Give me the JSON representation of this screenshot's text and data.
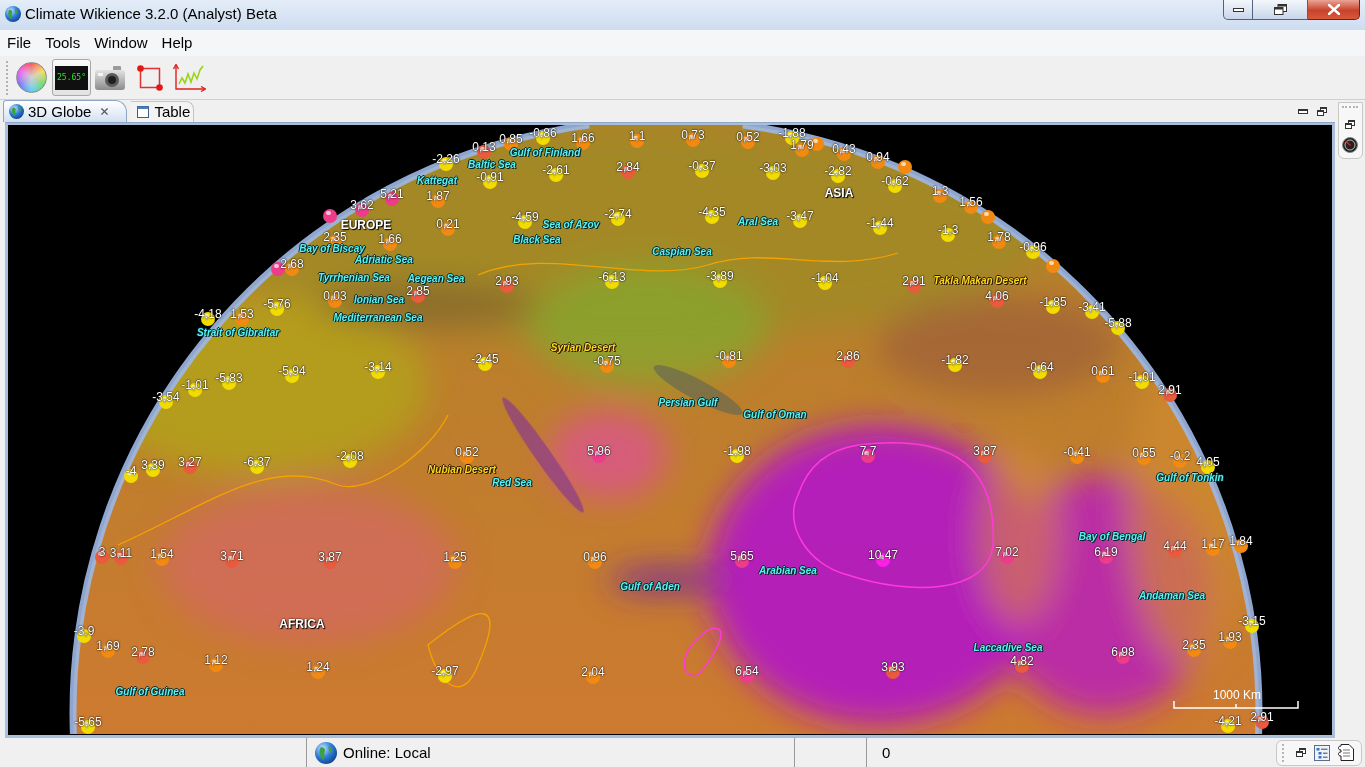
{
  "window": {
    "title": "Climate Wikience 3.2.0 (Analyst) Beta"
  },
  "menu": [
    "File",
    "Tools",
    "Window",
    "Help"
  ],
  "toolbar": {
    "temperature_display": "25.65°"
  },
  "tabs": [
    {
      "label": "3D Globe",
      "selected": true
    },
    {
      "label": "Table",
      "selected": false
    }
  ],
  "globe": {
    "labels": [
      {
        "kind": "water",
        "text": "Gulf of Finland"
      },
      {
        "kind": "water",
        "text": "Baltic Sea"
      },
      {
        "kind": "water",
        "text": "Kattegat"
      },
      {
        "kind": "continent",
        "text": "ASIA"
      },
      {
        "kind": "continent",
        "text": "EUROPE"
      },
      {
        "kind": "water",
        "text": "Sea of Azov"
      },
      {
        "kind": "water",
        "text": "Aral Sea"
      },
      {
        "kind": "water",
        "text": "Black Sea"
      },
      {
        "kind": "water",
        "text": "Bay of Biscay"
      },
      {
        "kind": "water",
        "text": "Caspian Sea"
      },
      {
        "kind": "water",
        "text": "Adriatic Sea"
      },
      {
        "kind": "water",
        "text": "Tyrrhenian Sea"
      },
      {
        "kind": "water",
        "text": "Aegean Sea"
      },
      {
        "kind": "desert",
        "text": "Takla Makan Desert"
      },
      {
        "kind": "water",
        "text": "Ionian Sea"
      },
      {
        "kind": "water",
        "text": "Mediterranean Sea"
      },
      {
        "kind": "water",
        "text": "Strait of Gibraltar"
      },
      {
        "kind": "desert",
        "text": "Syrian Desert"
      },
      {
        "kind": "water",
        "text": "Persian Gulf"
      },
      {
        "kind": "water",
        "text": "Gulf of Oman"
      },
      {
        "kind": "desert",
        "text": "Nubian Desert"
      },
      {
        "kind": "water",
        "text": "Red Sea"
      },
      {
        "kind": "water",
        "text": "Gulf of Tonkin"
      },
      {
        "kind": "water",
        "text": "Bay of Bengal"
      },
      {
        "kind": "water",
        "text": "Arabian Sea"
      },
      {
        "kind": "water",
        "text": "Gulf of Aden"
      },
      {
        "kind": "water",
        "text": "Andaman Sea"
      },
      {
        "kind": "continent",
        "text": "AFRICA"
      },
      {
        "kind": "water",
        "text": "Laccadive Sea"
      },
      {
        "kind": "water",
        "text": "Gulf of Guinea"
      }
    ],
    "markers": [
      {
        "value": "0,85",
        "color": "#f28a12"
      },
      {
        "value": "-0,86",
        "color": "#f2dc00"
      },
      {
        "value": "1,66",
        "color": "#f28a12"
      },
      {
        "value": "1,1",
        "color": "#f28a12"
      },
      {
        "value": "0,73",
        "color": "#f28a12"
      },
      {
        "value": "0,52",
        "color": "#f28a12"
      },
      {
        "value": "-1,88",
        "color": "#f2dc00"
      },
      {
        "value": "0,13",
        "color": "#ea5a3c"
      },
      {
        "value": "1,79",
        "color": "#f28a12"
      },
      {
        "color": "#f28a12"
      },
      {
        "value": "0,43",
        "color": "#f28a12"
      },
      {
        "value": "-2,26",
        "color": "#f2dc00"
      },
      {
        "value": "0,94",
        "color": "#f28a12"
      },
      {
        "value": "-2,61",
        "color": "#f2dc00"
      },
      {
        "value": "2,84",
        "color": "#ea5a3c"
      },
      {
        "value": "-0,37",
        "color": "#f2dc00"
      },
      {
        "value": "-3,03",
        "color": "#f2dc00"
      },
      {
        "value": "-2,82",
        "color": "#f2dc00"
      },
      {
        "color": "#f28a12"
      },
      {
        "value": "-0,91",
        "color": "#f2dc00"
      },
      {
        "value": "-0,62",
        "color": "#f2dc00"
      },
      {
        "value": "5,21",
        "color": "#ec3c8a"
      },
      {
        "value": "1,87",
        "color": "#f28a12"
      },
      {
        "value": "1,3",
        "color": "#f28a12"
      },
      {
        "value": "3,62",
        "color": "#ec3c8a"
      },
      {
        "value": "1,56",
        "color": "#f28a12"
      },
      {
        "color": "#ec3c8a"
      },
      {
        "value": "-4,59",
        "color": "#f2dc00"
      },
      {
        "value": "-2,74",
        "color": "#f2dc00"
      },
      {
        "value": "-4,35",
        "color": "#f2dc00"
      },
      {
        "value": "-3,47",
        "color": "#f2dc00"
      },
      {
        "color": "#f28a12"
      },
      {
        "value": "0,21",
        "color": "#f28a12"
      },
      {
        "value": "-1,44",
        "color": "#f2dc00"
      },
      {
        "value": "-1,3",
        "color": "#f2dc00"
      },
      {
        "value": "2,35",
        "color": "#f28a12"
      },
      {
        "value": "1,66",
        "color": "#f28a12"
      },
      {
        "value": "1,78",
        "color": "#f28a12"
      },
      {
        "value": "-0,96",
        "color": "#f2dc00"
      },
      {
        "color": "#ec3c8a"
      },
      {
        "value": "2,68",
        "color": "#f28a12"
      },
      {
        "color": "#f28a12"
      },
      {
        "value": "2,93",
        "color": "#ea5a3c"
      },
      {
        "value": "-6,13",
        "color": "#f2dc00"
      },
      {
        "value": "-3,89",
        "color": "#f2dc00"
      },
      {
        "value": "-1,04",
        "color": "#f2dc00"
      },
      {
        "value": "2,91",
        "color": "#ea5a3c"
      },
      {
        "value": "0,03",
        "color": "#f28a12"
      },
      {
        "value": "2,85",
        "color": "#ea5a3c"
      },
      {
        "value": "4,06",
        "color": "#ea5a3c"
      },
      {
        "value": "-5,76",
        "color": "#f2dc00"
      },
      {
        "value": "-1,85",
        "color": "#f2dc00"
      },
      {
        "value": "-3,41",
        "color": "#f2dc00"
      },
      {
        "value": "-4,18",
        "color": "#f2dc00"
      },
      {
        "value": "1,53",
        "color": "#f28a12"
      },
      {
        "value": "-5,88",
        "color": "#f2dc00"
      },
      {
        "value": "-2,45",
        "color": "#f2dc00"
      },
      {
        "value": "-0,75",
        "color": "#f28a12"
      },
      {
        "value": "-0,81",
        "color": "#f28a12"
      },
      {
        "value": "2,86",
        "color": "#ea5a3c"
      },
      {
        "value": "-1,82",
        "color": "#f2dc00"
      },
      {
        "value": "-5,94",
        "color": "#f2dc00"
      },
      {
        "value": "-3,14",
        "color": "#f2dc00"
      },
      {
        "value": "-0,64",
        "color": "#f2dc00"
      },
      {
        "value": "0,61",
        "color": "#f28a12"
      },
      {
        "value": "-5,83",
        "color": "#f2dc00"
      },
      {
        "value": "-1,01",
        "color": "#f2dc00"
      },
      {
        "value": "-1,01",
        "color": "#f2dc00"
      },
      {
        "value": "2,91",
        "color": "#ea5a3c"
      },
      {
        "value": "-3,54",
        "color": "#f2dc00"
      },
      {
        "value": "-2,08",
        "color": "#f2dc00"
      },
      {
        "value": "0,52",
        "color": "#f28a12"
      },
      {
        "value": "5,96",
        "color": "#ec3c8a"
      },
      {
        "value": "-1,98",
        "color": "#f2dc00"
      },
      {
        "value": "7,7",
        "color": "#ec3c8a"
      },
      {
        "value": "3,87",
        "color": "#ea5a3c"
      },
      {
        "value": "-0,41",
        "color": "#f28a12"
      },
      {
        "value": "0,55",
        "color": "#f28a12"
      },
      {
        "value": "-0,2",
        "color": "#f28a12"
      },
      {
        "value": "3,39",
        "color": "#f2dc00"
      },
      {
        "value": "3,27",
        "color": "#ea5a3c"
      },
      {
        "value": "-6,37",
        "color": "#f2dc00"
      },
      {
        "value": "4,05",
        "color": "#f2dc00"
      },
      {
        "value": "-4",
        "color": "#f2dc00"
      },
      {
        "value": "4,44",
        "color": "#ea5a3c"
      },
      {
        "value": "1,17",
        "color": "#f28a12"
      },
      {
        "value": "1,84",
        "color": "#f28a12"
      },
      {
        "value": "3",
        "color": "#ea5a3c"
      },
      {
        "value": "3,11",
        "color": "#ea5a3c"
      },
      {
        "value": "1,54",
        "color": "#f28a12"
      },
      {
        "value": "3,71",
        "color": "#ea5a3c"
      },
      {
        "value": "3,87",
        "color": "#ea5a3c"
      },
      {
        "value": "1,25",
        "color": "#f28a12"
      },
      {
        "value": "0,96",
        "color": "#f28a12"
      },
      {
        "value": "5,65",
        "color": "#ec3c8a"
      },
      {
        "value": "10,47",
        "color": "#ff1ee8"
      },
      {
        "value": "7,02",
        "color": "#ec3c8a"
      },
      {
        "value": "6,19",
        "color": "#ec3c8a"
      },
      {
        "value": "-3,15",
        "color": "#f2dc00"
      },
      {
        "value": "-3,9",
        "color": "#f2dc00"
      },
      {
        "value": "1,93",
        "color": "#f28a12"
      },
      {
        "value": "1,69",
        "color": "#f28a12"
      },
      {
        "value": "2,35",
        "color": "#f28a12"
      },
      {
        "value": "2,78",
        "color": "#ea5a3c"
      },
      {
        "value": "6,98",
        "color": "#ec3c8a"
      },
      {
        "value": "1,12",
        "color": "#f28a12"
      },
      {
        "value": "4,82",
        "color": "#ea5a3c"
      },
      {
        "value": "1,24",
        "color": "#f28a12"
      },
      {
        "value": "-2,97",
        "color": "#f2dc00"
      },
      {
        "value": "2,04",
        "color": "#f28a12"
      },
      {
        "value": "6,54",
        "color": "#ec3c8a"
      },
      {
        "value": "3,93",
        "color": "#ea5a3c"
      },
      {
        "value": "-5,65",
        "color": "#f2dc00"
      },
      {
        "value": "-4,21",
        "color": "#f2dc00"
      },
      {
        "value": "2,91",
        "color": "#ea5a3c"
      }
    ],
    "scale": "1000 Km"
  },
  "status_bar": {
    "connection": "Online: Local",
    "count": "0"
  }
}
